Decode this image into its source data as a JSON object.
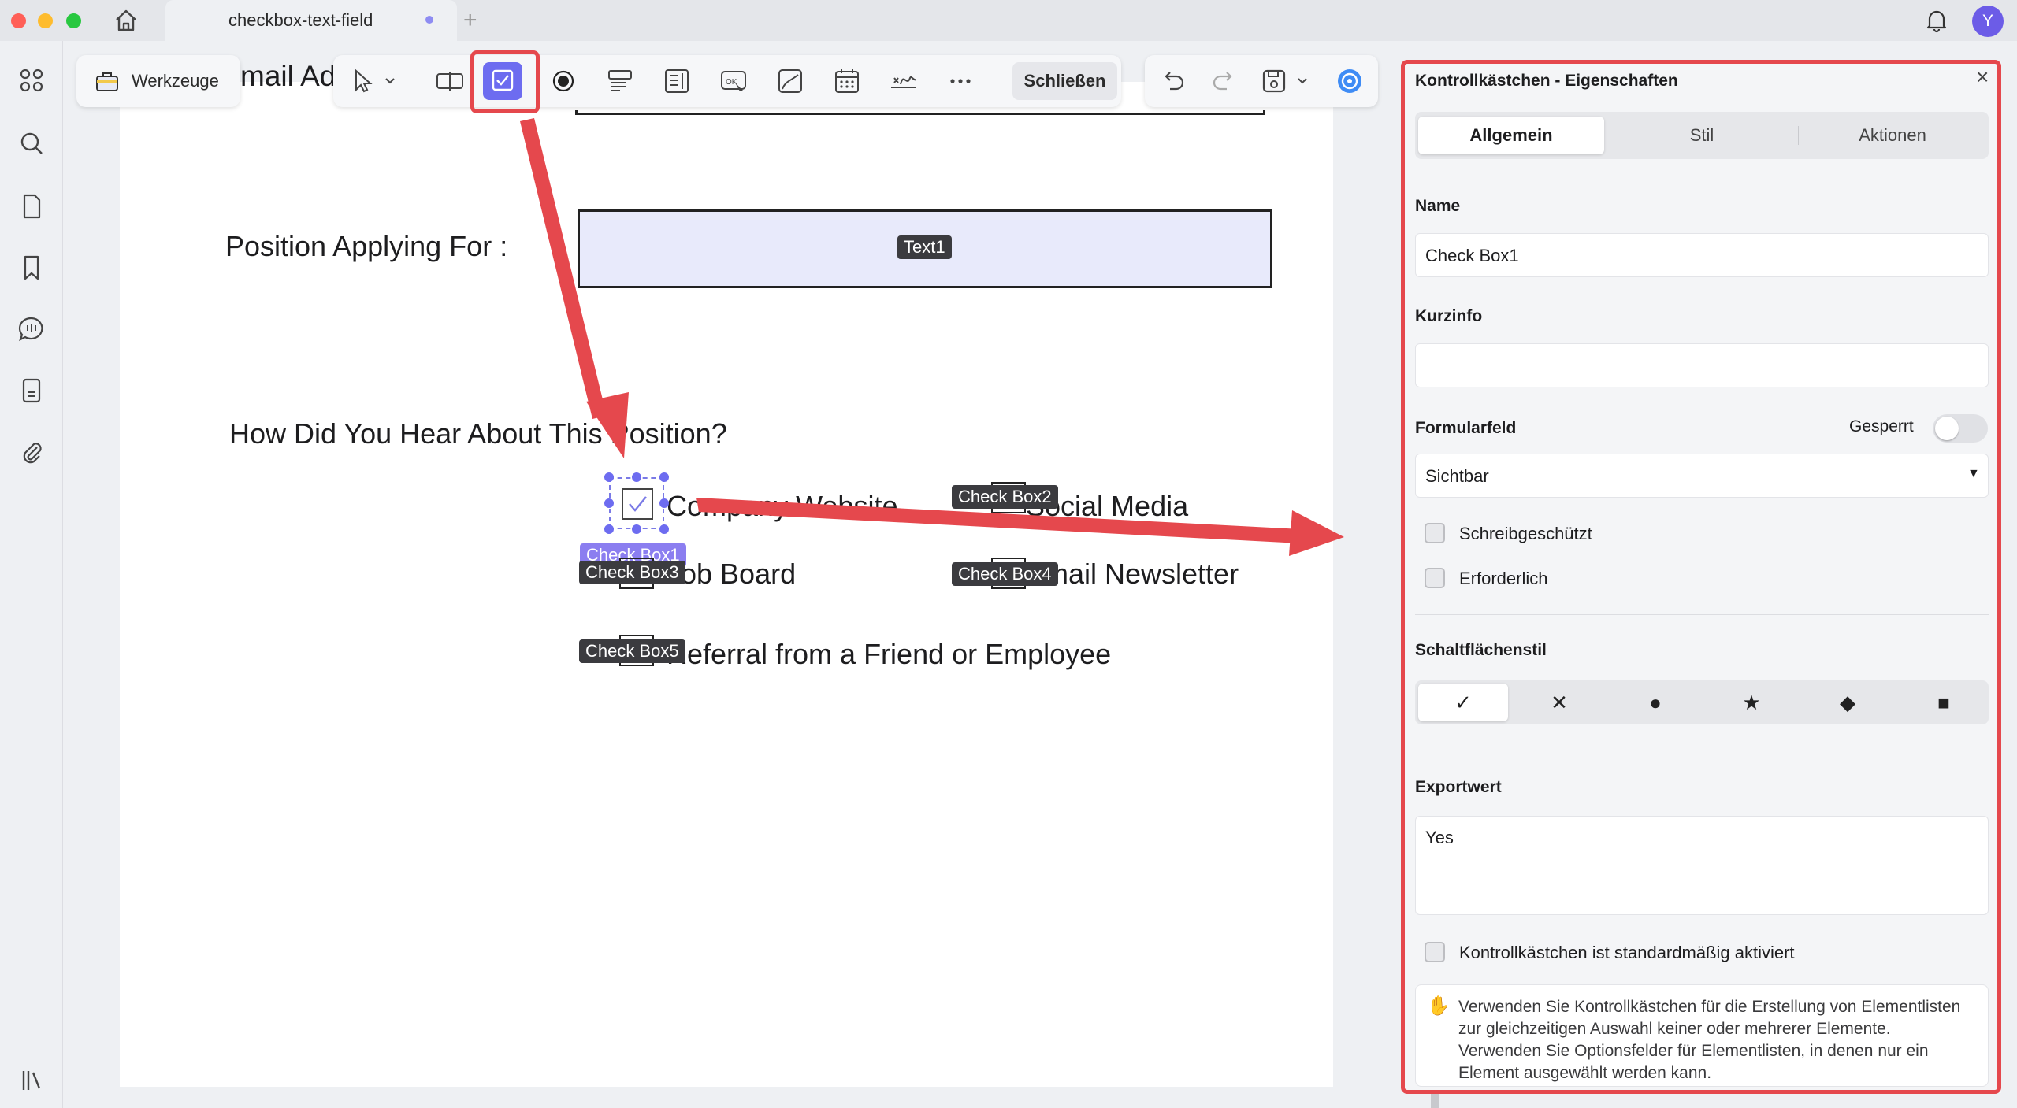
{
  "window": {
    "tab_title": "checkbox-text-field",
    "avatar_initial": "Y"
  },
  "tools": {
    "label": "Werkzeuge"
  },
  "toolbar": {
    "close_label": "Schließen"
  },
  "document": {
    "email_partial": "mail Ad",
    "position_label": "Position Applying For :",
    "textfield_tag": "Text1",
    "question": "How Did You Hear About This Position?",
    "options": {
      "company_website": "Company Website",
      "social_media": "Social Media",
      "job_board": "Job Board",
      "email_newsletter": "Email Newsletter",
      "referral": "Referral from a Friend or Employee"
    },
    "checkbox_tags": [
      "Check Box1",
      "Check Box2",
      "Check Box3",
      "Check Box4",
      "Check Box5"
    ]
  },
  "panel": {
    "title": "Kontrollkästchen - Eigenschaften",
    "tabs": [
      "Allgemein",
      "Stil",
      "Aktionen"
    ],
    "name_label": "Name",
    "name_value": "Check Box1",
    "tooltip_label": "Kurzinfo",
    "tooltip_value": "",
    "formfield_label": "Formularfeld",
    "locked_label": "Gesperrt",
    "visibility_value": "Sichtbar",
    "readonly_label": "Schreibgeschützt",
    "required_label": "Erforderlich",
    "button_style_label": "Schaltflächenstil",
    "button_styles": [
      "✓",
      "✕",
      "●",
      "★",
      "◆",
      "■"
    ],
    "export_label": "Exportwert",
    "export_value": "Yes",
    "default_checked_label": "Kontrollkästchen ist standardmäßig aktiviert",
    "info_text": "Verwenden Sie Kontrollkästchen für die Erstellung von Elementlisten zur gleichzeitigen Auswahl keiner oder mehrerer Elemente. Verwenden Sie Optionsfelder für Elementlisten, in denen nur ein Element ausgewählt werden kann."
  },
  "colors": {
    "accent": "#6d6cf0",
    "annotation_red": "#e5484d",
    "field_fill": "#e8eafb"
  }
}
